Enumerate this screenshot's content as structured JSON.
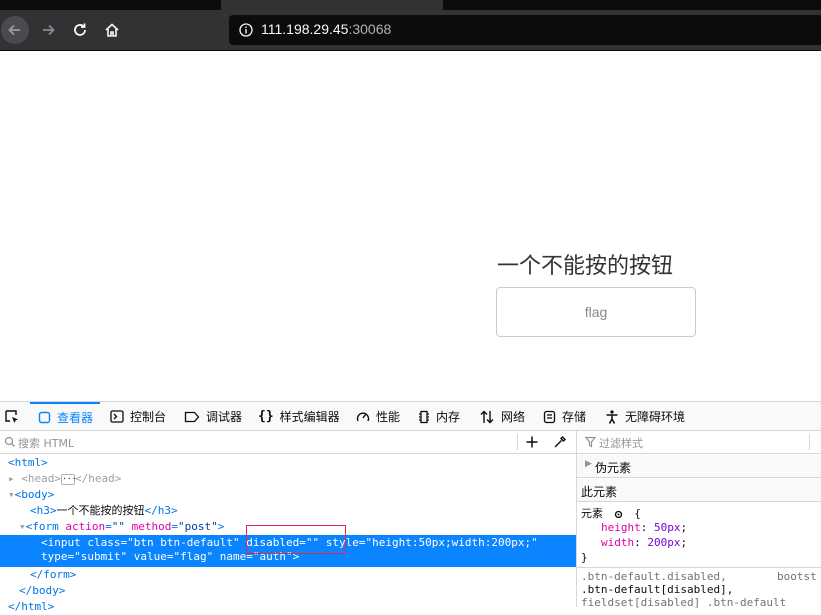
{
  "browser": {
    "url_host": "111.198.29.45",
    "url_port": ":30068"
  },
  "page": {
    "heading": "一个不能按的按钮",
    "button_value": "flag"
  },
  "devtools": {
    "tabs": [
      {
        "label": "查看器",
        "icon": "inspector-icon"
      },
      {
        "label": "控制台",
        "icon": "console-icon"
      },
      {
        "label": "调试器",
        "icon": "debugger-icon"
      },
      {
        "label": "样式编辑器",
        "icon": "style-editor-icon"
      },
      {
        "label": "性能",
        "icon": "performance-icon"
      },
      {
        "label": "内存",
        "icon": "memory-icon"
      },
      {
        "label": "网络",
        "icon": "network-icon"
      },
      {
        "label": "存储",
        "icon": "storage-icon"
      },
      {
        "label": "无障碍环境",
        "icon": "accessibility-icon"
      }
    ],
    "search_placeholder": "搜索 HTML",
    "filter_placeholder": "过滤样式",
    "tree": {
      "html_open": "<html>",
      "head": "<head>",
      "head_close": "</head>",
      "body_open": "<body>",
      "h3_open": "<h3>",
      "h3_text": "一个不能按的按钮",
      "h3_close": "</h3>",
      "form_tag": "<form",
      "form_attr1": "action",
      "form_val1": "\"\"",
      "form_attr2": "method",
      "form_val2": "\"post\"",
      "form_end": ">",
      "input_line1": "<input class=\"btn btn-default\" disabled=\"\" style=\"height:50px;width:200px;\"",
      "input_line2": "type=\"submit\" value=\"flag\" name=\"auth\">",
      "form_close": "</form>",
      "body_close": "</body>",
      "html_close": "</html>"
    },
    "rules": {
      "pseudo_elements": "伪元素",
      "this_element": "此元素",
      "element_label": "元素",
      "brace_open": "{",
      "prop1": "height",
      "val1": "50px",
      "prop2": "width",
      "val2": "200px",
      "brace_close": "}",
      "sel1": ".btn-default.disabled,",
      "source": "bootst",
      "sel2": ".btn-default[disabled],",
      "sel3": "fieldset[disabled] .btn-default"
    }
  }
}
